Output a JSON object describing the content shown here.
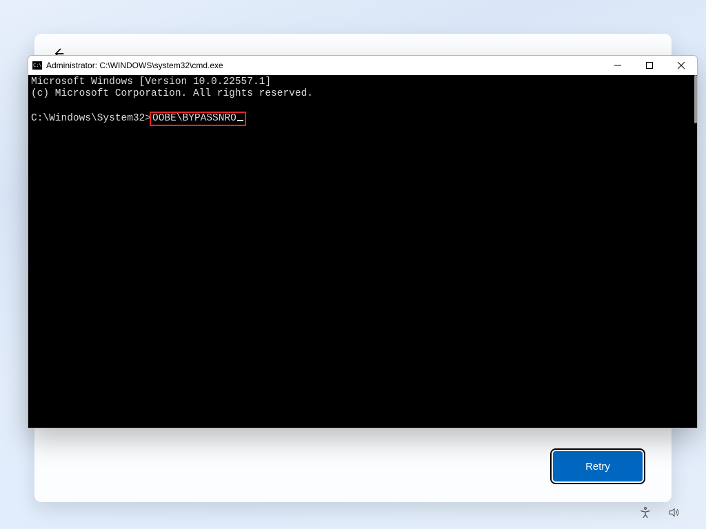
{
  "oobe": {
    "retry_label": "Retry"
  },
  "cmd": {
    "title": "Administrator: C:\\WINDOWS\\system32\\cmd.exe",
    "line1": "Microsoft Windows [Version 10.0.22557.1]",
    "line2": "(c) Microsoft Corporation. All rights reserved.",
    "prompt": "C:\\Windows\\System32>",
    "command": "OOBE\\BYPASSNRO"
  },
  "tray": {
    "accessibility": "accessibility-icon",
    "volume": "volume-icon"
  }
}
